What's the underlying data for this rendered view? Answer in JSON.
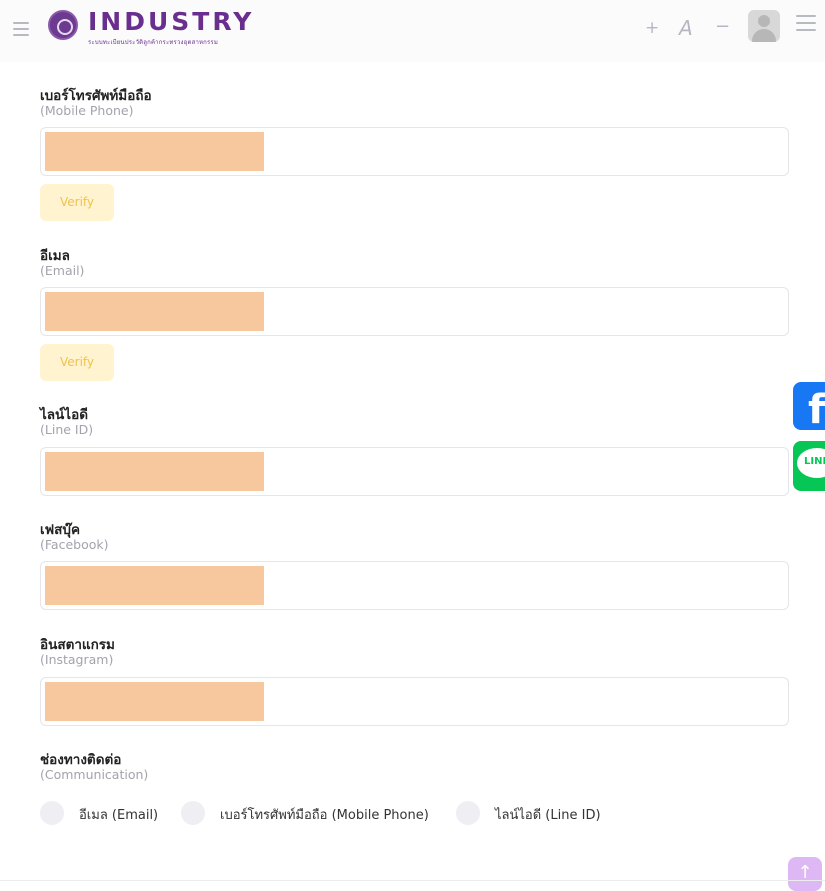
{
  "header": {
    "logo_text": "INDUSTRY",
    "logo_subtitle": "ระบบทะเบียนประวัติลูกค้ากระทรวงอุตสาหกรรม",
    "font_increase": "+",
    "font_label": "A",
    "font_decrease": "−"
  },
  "form": {
    "mobile": {
      "label": "เบอร์โทรศัพท์มือถือ",
      "sublabel": "(Mobile Phone)",
      "verify_label": "Verify"
    },
    "email": {
      "label": "อีเมล",
      "sublabel": "(Email)",
      "verify_label": "Verify"
    },
    "line": {
      "label": "ไลน์ไอดี",
      "sublabel": "(Line ID)"
    },
    "facebook": {
      "label": "เฟสบุ๊ค",
      "sublabel": "(Facebook)"
    },
    "instagram": {
      "label": "อินสตาแกรม",
      "sublabel": "(Instagram)"
    },
    "communication": {
      "label": "ช่องทางติดต่อ",
      "sublabel": "(Communication)",
      "options": [
        "อีเมล (Email)",
        "เบอร์โทรศัพท์มือถือ (Mobile Phone)",
        "ไลน์ไอดี (Line ID)"
      ]
    }
  },
  "side": {
    "facebook_letter": "f",
    "line_text": "LINE"
  },
  "scroll_top_symbol": "↑",
  "colors": {
    "brand": "#6a2f8e",
    "redaction": "#f7c89e",
    "verify_bg": "#fff4cf",
    "verify_text": "#f0c24a",
    "facebook": "#1877f2",
    "line": "#06c755",
    "scroll_top": "#ddb8f5"
  }
}
